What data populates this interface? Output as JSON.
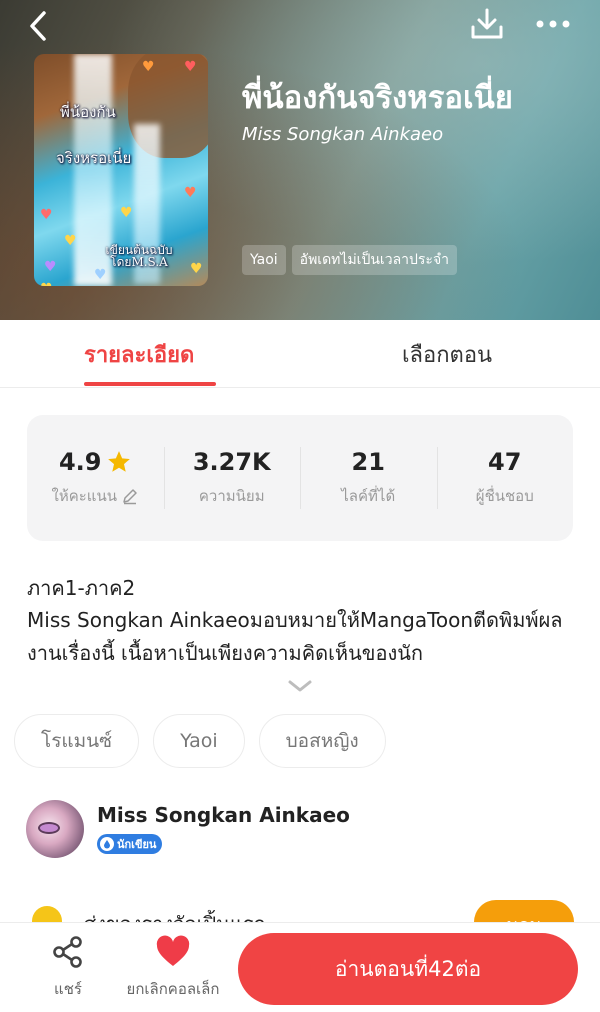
{
  "header": {
    "title": "พี่น้องกันจริงหรอเนี่ย",
    "author": "Miss Songkan Ainkaeo",
    "tags": [
      "Yaoi",
      "อัพเดทไม่เป็นเวลาประจำ"
    ],
    "cover_text": {
      "line1": "พี่น้องกัน",
      "line2": "จริงหรอเนี่ย",
      "line3": "เขียนต้นฉบับ โดยM.S.A"
    }
  },
  "tabs": [
    "รายละเอียด",
    "เลือกตอน"
  ],
  "stats": [
    {
      "value": "4.9",
      "label": "ให้คะแนน"
    },
    {
      "value": "3.27K",
      "label": "ความนิยม"
    },
    {
      "value": "21",
      "label": "ไลค์ที่ได้"
    },
    {
      "value": "47",
      "label": "ผู้ชื่นชอบ"
    }
  ],
  "description": {
    "heading": "ภาค1-ภาค2",
    "body": "Miss Songkan Ainkaeoมอบหมายให้MangaToonตีดพิมพ์ผลงานเรื่องนี้ เนื้อหาเป็นเพียงความคิดเห็นของนัก"
  },
  "genres": [
    "โรแมนซ์",
    "Yaoi",
    "บอสหญิง"
  ],
  "author_block": {
    "name": "Miss Songkan Ainkaeo",
    "badge": "นักเขียน"
  },
  "peek_row": {
    "text": "สุ่งของรางวัลเปิ้นแรก",
    "button": "นอน"
  },
  "bottom": {
    "share_label": "แชร์",
    "unfollow_label": "ยกเลิกคอลเล็ก",
    "read_button": "อ่านตอนที่42ต่อ"
  },
  "colors": {
    "accent": "#ef4444",
    "star": "#f5b800",
    "badge": "#2f7de1"
  },
  "icons": [
    "back-icon",
    "download-icon",
    "more-icon",
    "star-icon",
    "edit-icon",
    "chevron-down-icon",
    "share-icon",
    "heart-icon"
  ]
}
